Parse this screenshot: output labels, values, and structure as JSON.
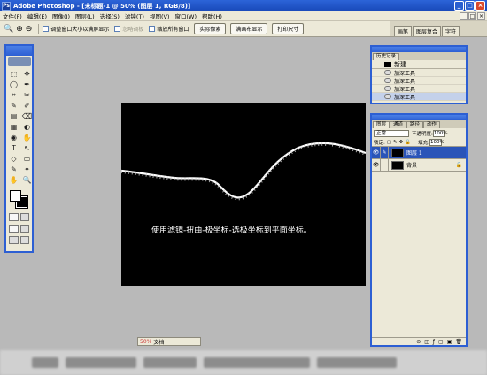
{
  "window": {
    "title": "Adobe Photoshop - [未标题-1 @ 50% (图层 1, RGB/8)]",
    "logo_text": "Ps",
    "buttons": [
      "_",
      "□",
      "×"
    ]
  },
  "menubar": {
    "items": [
      "文件(F)",
      "编辑(E)",
      "图像(I)",
      "图层(L)",
      "选择(S)",
      "滤镜(T)",
      "视图(V)",
      "窗口(W)",
      "帮助(H)"
    ],
    "doc_controls": [
      "_",
      "□",
      "×"
    ]
  },
  "options": {
    "zoom_icon": "zoom-icon",
    "zoom_glyph": "🔍",
    "fit_window_label": "调整窗口大小以满屏显示",
    "ignore_palettes_label": "忽略调板",
    "zoom_all_label": "缩放所有窗口",
    "actual_pixels_label": "实际像素",
    "fit_on_screen_label": "满画布显示",
    "print_size_label": "打印尺寸",
    "well_tabs": [
      "画笔",
      "图层复合",
      "字符"
    ]
  },
  "toolbox": {
    "tools": [
      "⬚",
      "✥",
      "◯",
      "✒",
      "⌗",
      "✂",
      "✎",
      "✐",
      "▤",
      "⌫",
      "▦",
      "◐",
      "◉",
      "✋",
      "T",
      "↖",
      "◇",
      "▭",
      "✎",
      "✦",
      "✋",
      "🔍"
    ]
  },
  "canvas": {
    "caption": "使用滤镜-扭曲-极坐标-选极坐标到平面坐标。",
    "background": "#000000"
  },
  "history": {
    "tabs": [
      "历史记录"
    ],
    "snapshot_label": "新建",
    "items": [
      {
        "label": "加深工具"
      },
      {
        "label": "加深工具"
      },
      {
        "label": "加深工具"
      },
      {
        "label": "加深工具"
      }
    ]
  },
  "layers": {
    "tabs": [
      "图层",
      "通道",
      "路径",
      "动作"
    ],
    "blend_mode": "正常",
    "opacity_label": "不透明度:",
    "opacity_value": "100%",
    "lock_label": "锁定:",
    "fill_label": "填充:",
    "fill_value": "100%",
    "items": [
      {
        "name": "图层 1",
        "active": true
      },
      {
        "name": "背景",
        "active": false
      }
    ],
    "footer_icons": [
      "⊙",
      "◫",
      "ƒ",
      "▢",
      "▣",
      "🗑"
    ]
  },
  "docstatus": {
    "zoom": "50%",
    "label": "文档"
  }
}
